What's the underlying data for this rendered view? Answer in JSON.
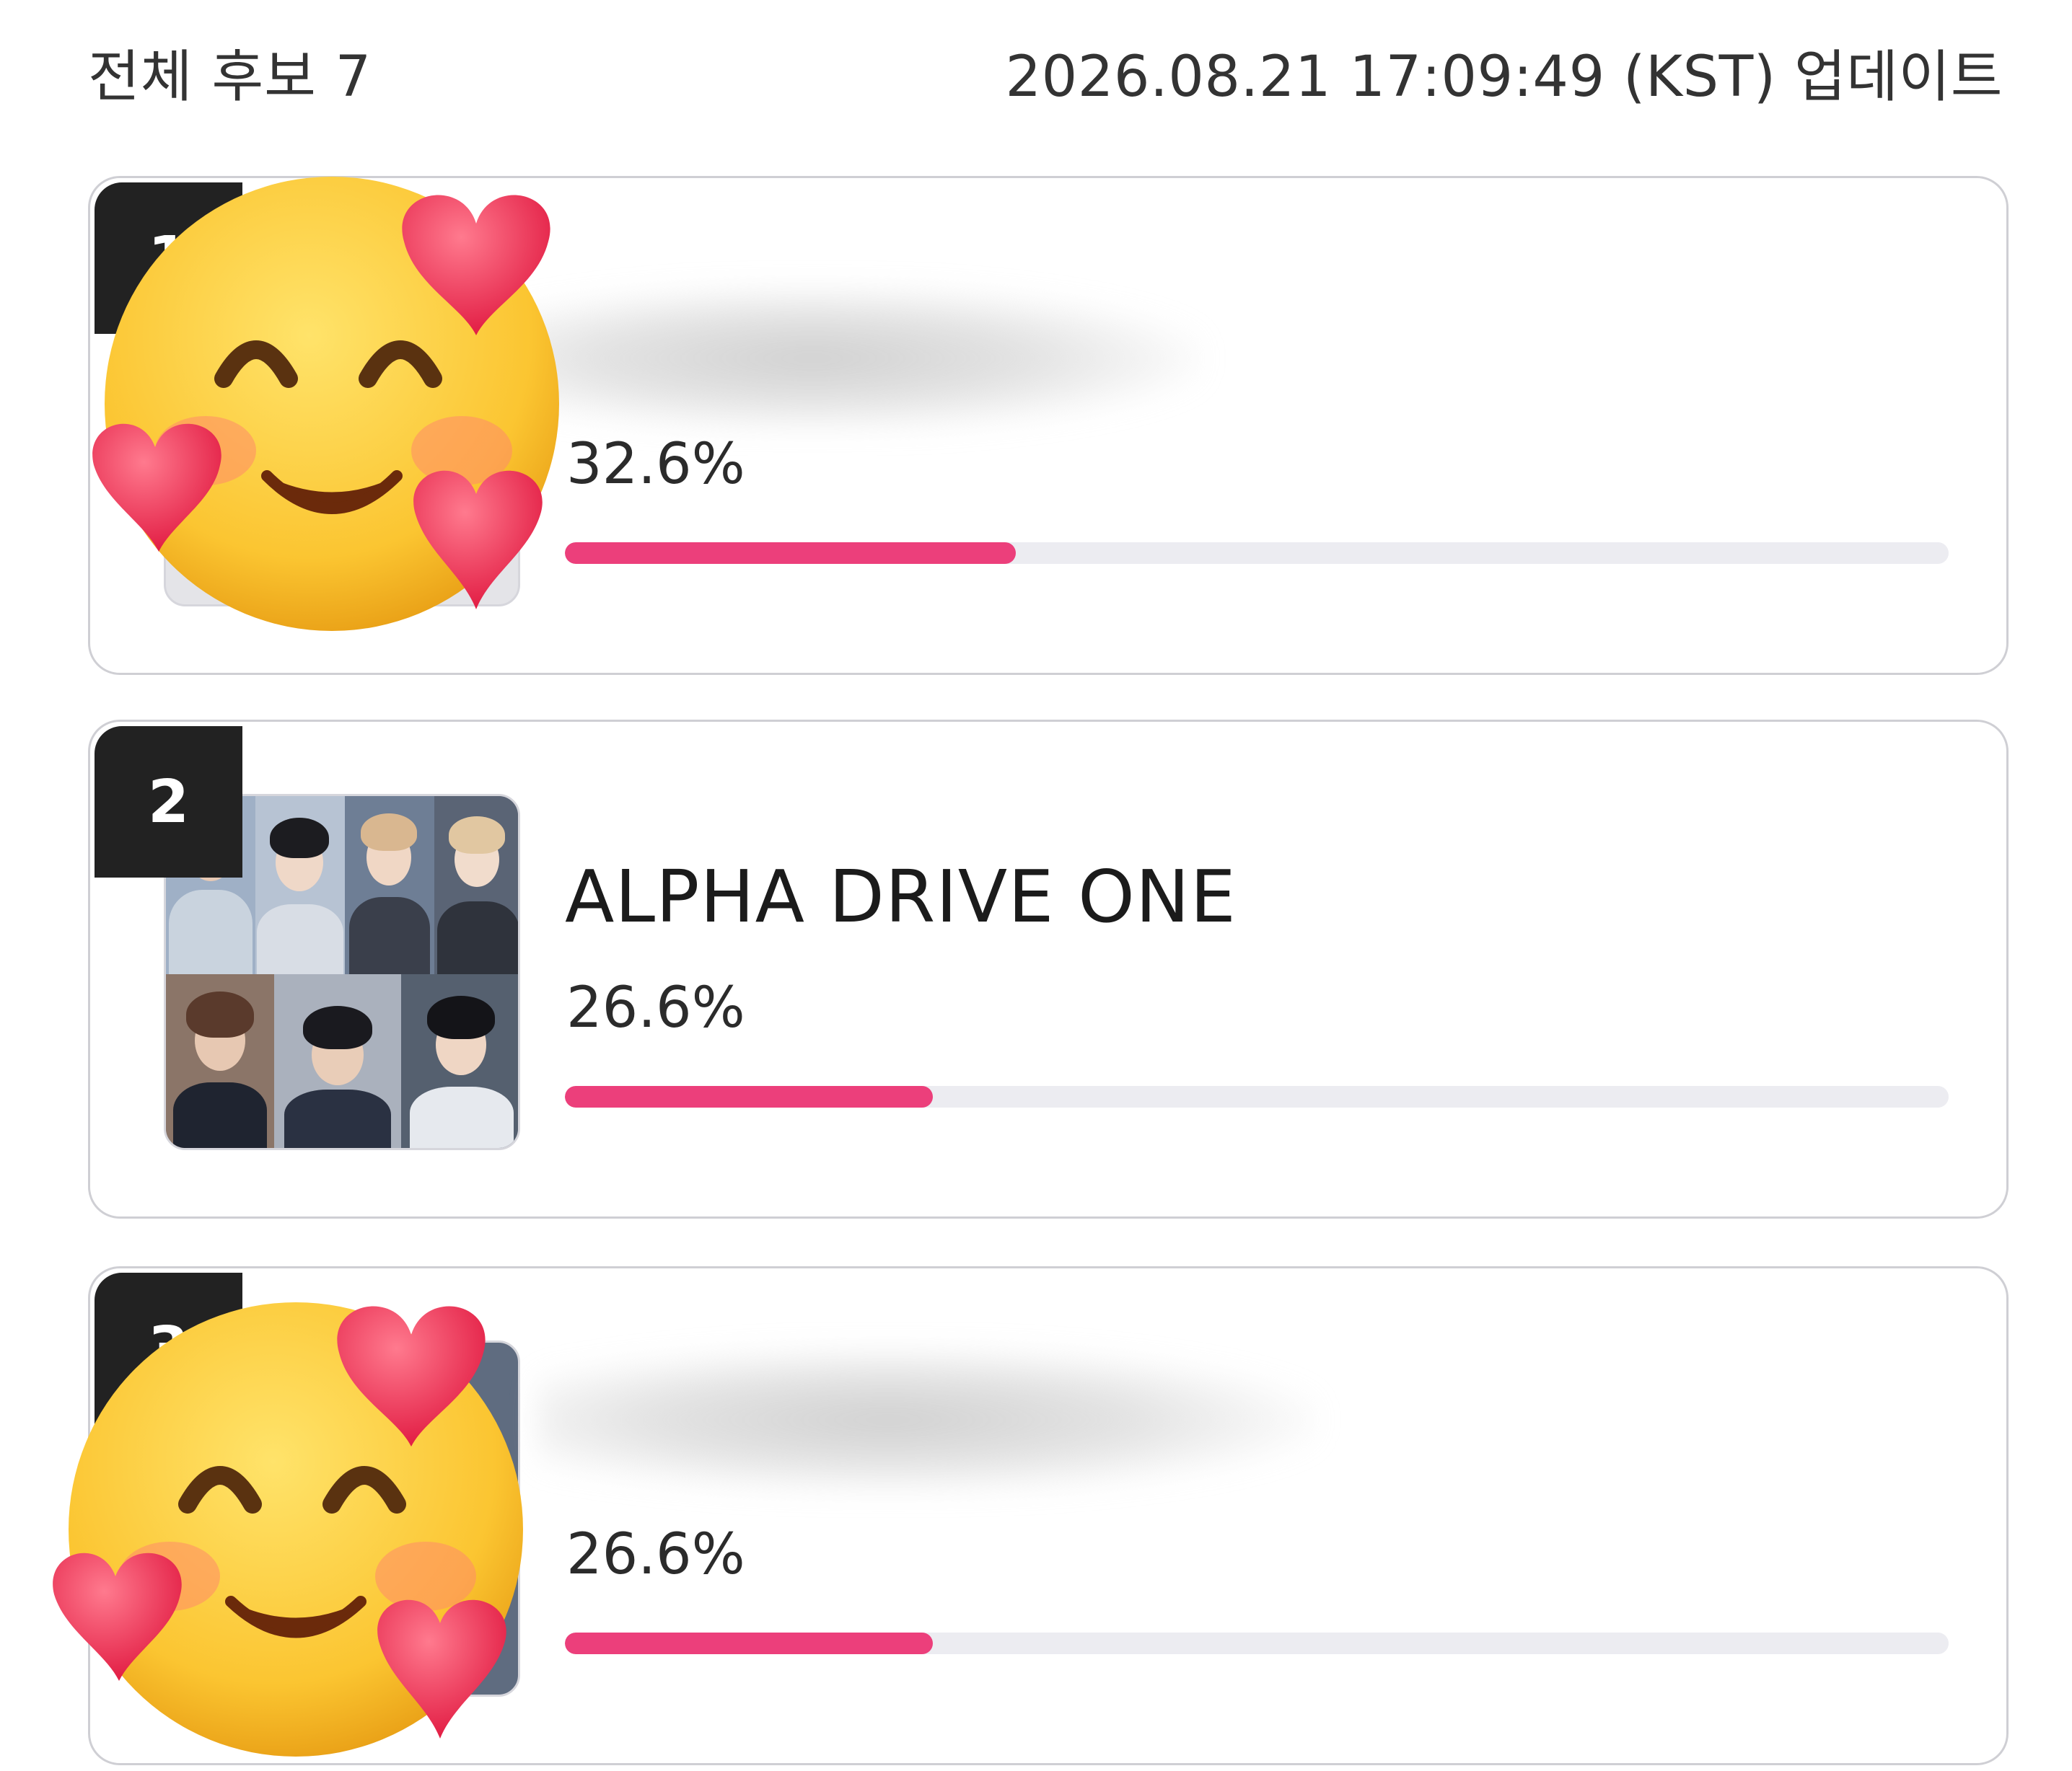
{
  "header": {
    "total_candidates": "전체 후보 7",
    "updated": "2026.08.21 17:09:49 (KST) 업데이트"
  },
  "candidates": [
    {
      "rank": "1",
      "name": "",
      "percent_label": "32.6%",
      "progress_fraction": 0.326,
      "name_obscured": true
    },
    {
      "rank": "2",
      "name": "ALPHA DRIVE ONE",
      "percent_label": "26.6%",
      "progress_fraction": 0.266,
      "name_obscured": false
    },
    {
      "rank": "3",
      "name": "",
      "percent_label": "26.6%",
      "progress_fraction": 0.266,
      "name_obscured": true
    }
  ],
  "colors": {
    "progress_fill": "#ec3f7b",
    "progress_track": "#ececf1",
    "rank_badge": "#222222",
    "card_border": "#cfcfd4"
  },
  "overlays": {
    "emoji": "smiling-face-with-hearts-icon"
  }
}
